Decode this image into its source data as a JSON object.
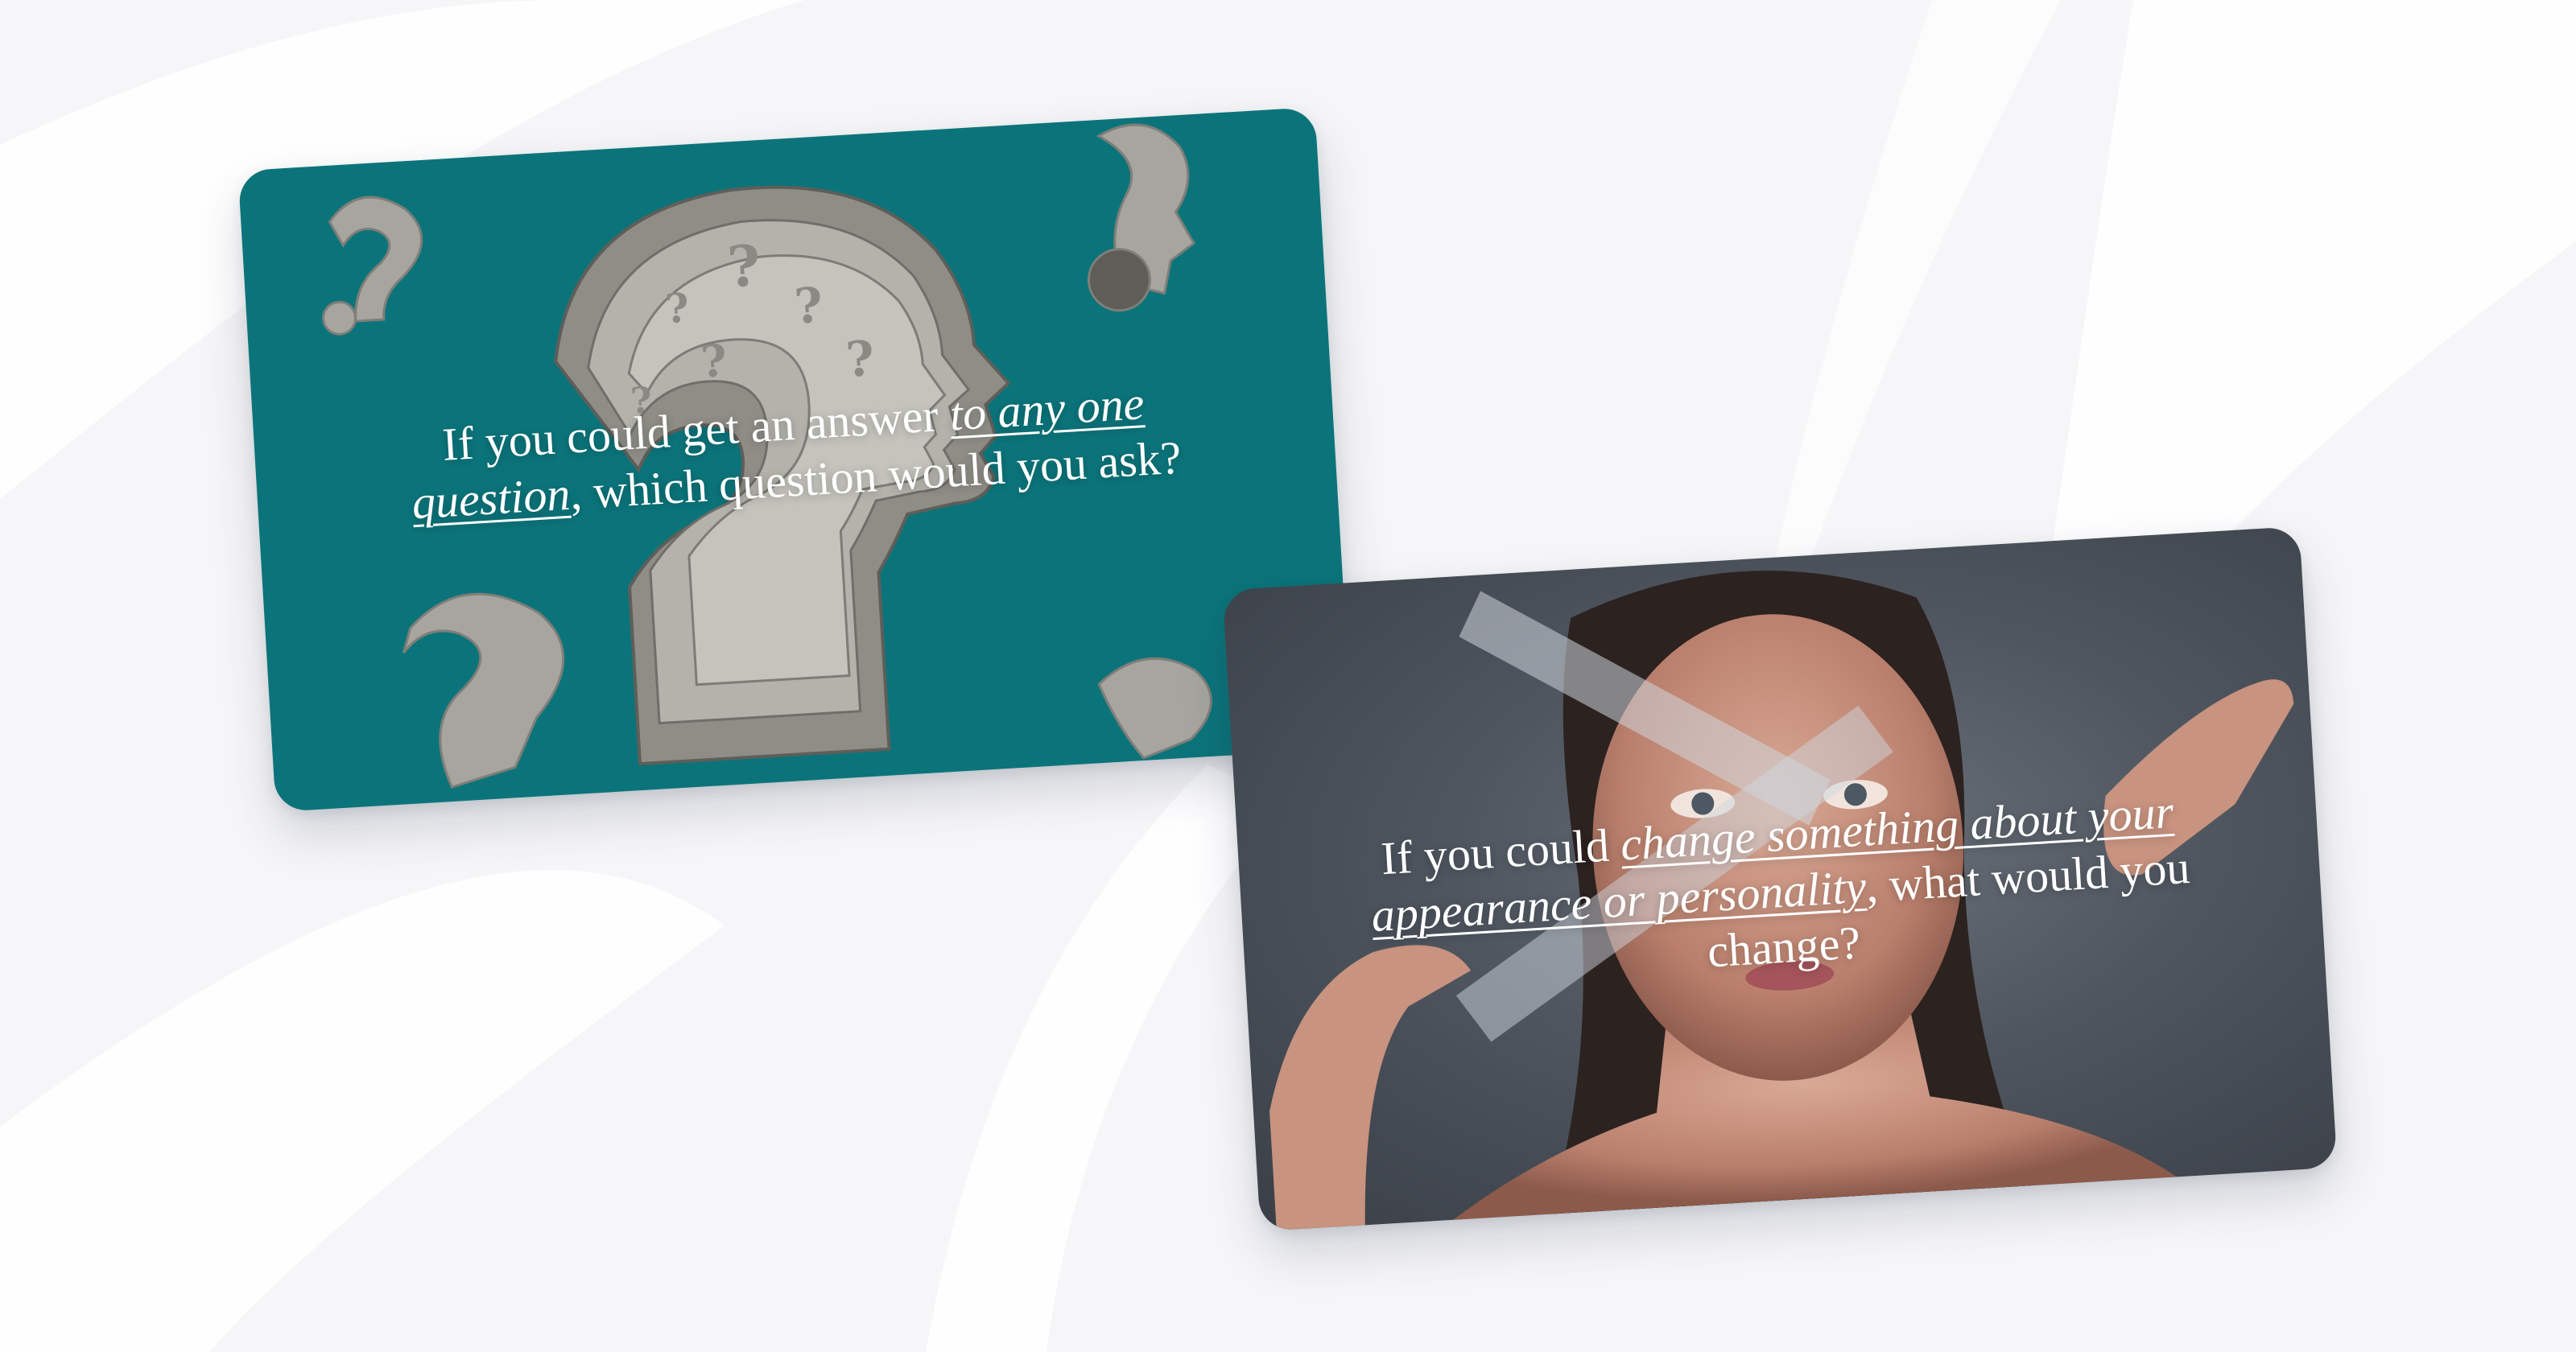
{
  "colors": {
    "page_background": "#f6f6f8",
    "teal_card": "#0b747a",
    "paper_grey": "#a6a59f",
    "text": "#ffffff"
  },
  "cards": [
    {
      "theme": "teal paper-cut question mark head",
      "prefix": "If you could get an answer ",
      "emphasis": "to any one question",
      "suffix": ", which question would you ask?"
    },
    {
      "theme": "photo of person with tape on face",
      "prefix": "If you could ",
      "emphasis": "change something about your appearance or personality",
      "suffix": ", what would you change?"
    }
  ]
}
